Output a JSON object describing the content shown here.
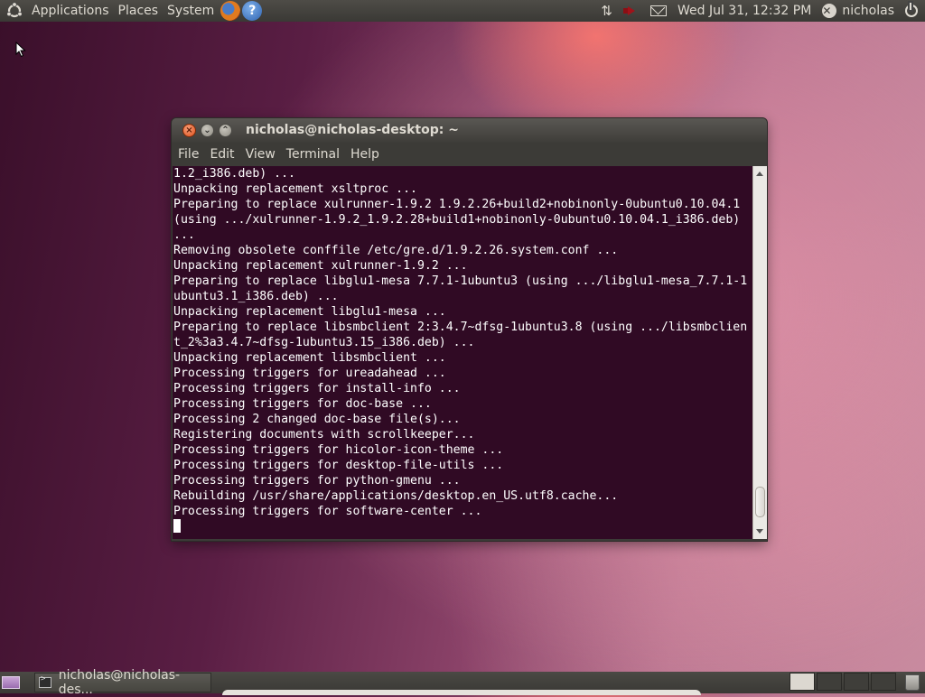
{
  "top_panel": {
    "menus": [
      {
        "label": "Applications"
      },
      {
        "label": "Places"
      },
      {
        "label": "System"
      }
    ],
    "launchers": [
      "firefox-icon",
      "help-icon"
    ],
    "tray": {
      "icons": [
        "network-icon",
        "volume-icon",
        "mail-icon"
      ],
      "clock": "Wed Jul 31, 12:32 PM",
      "user": "nicholas",
      "power_icon": "power-icon"
    }
  },
  "terminal": {
    "title": "nicholas@nicholas-desktop: ~",
    "menus": [
      {
        "label": "File"
      },
      {
        "label": "Edit"
      },
      {
        "label": "View"
      },
      {
        "label": "Terminal"
      },
      {
        "label": "Help"
      }
    ],
    "lines": [
      "1.2_i386.deb) ...",
      "Unpacking replacement xsltproc ...",
      "Preparing to replace xulrunner-1.9.2 1.9.2.26+build2+nobinonly-0ubuntu0.10.04.1",
      "(using .../xulrunner-1.9.2_1.9.2.28+build1+nobinonly-0ubuntu0.10.04.1_i386.deb)",
      "...",
      "Removing obsolete conffile /etc/gre.d/1.9.2.26.system.conf ...",
      "Unpacking replacement xulrunner-1.9.2 ...",
      "Preparing to replace libglu1-mesa 7.7.1-1ubuntu3 (using .../libglu1-mesa_7.7.1-1",
      "ubuntu3.1_i386.deb) ...",
      "Unpacking replacement libglu1-mesa ...",
      "Preparing to replace libsmbclient 2:3.4.7~dfsg-1ubuntu3.8 (using .../libsmbclien",
      "t_2%3a3.4.7~dfsg-1ubuntu3.15_i386.deb) ...",
      "Unpacking replacement libsmbclient ...",
      "Processing triggers for ureadahead ...",
      "Processing triggers for install-info ...",
      "Processing triggers for doc-base ...",
      "Processing 2 changed doc-base file(s)...",
      "Registering documents with scrollkeeper...",
      "Processing triggers for hicolor-icon-theme ...",
      "Processing triggers for desktop-file-utils ...",
      "Processing triggers for python-gmenu ...",
      "Rebuilding /usr/share/applications/desktop.en_US.utf8.cache...",
      "Processing triggers for software-center ..."
    ],
    "colors": {
      "background": "#300a24",
      "text": "#ffffff"
    }
  },
  "bottom_panel": {
    "task_label": "nicholas@nicholas-des...",
    "workspace_count": 4,
    "active_workspace": 1
  }
}
